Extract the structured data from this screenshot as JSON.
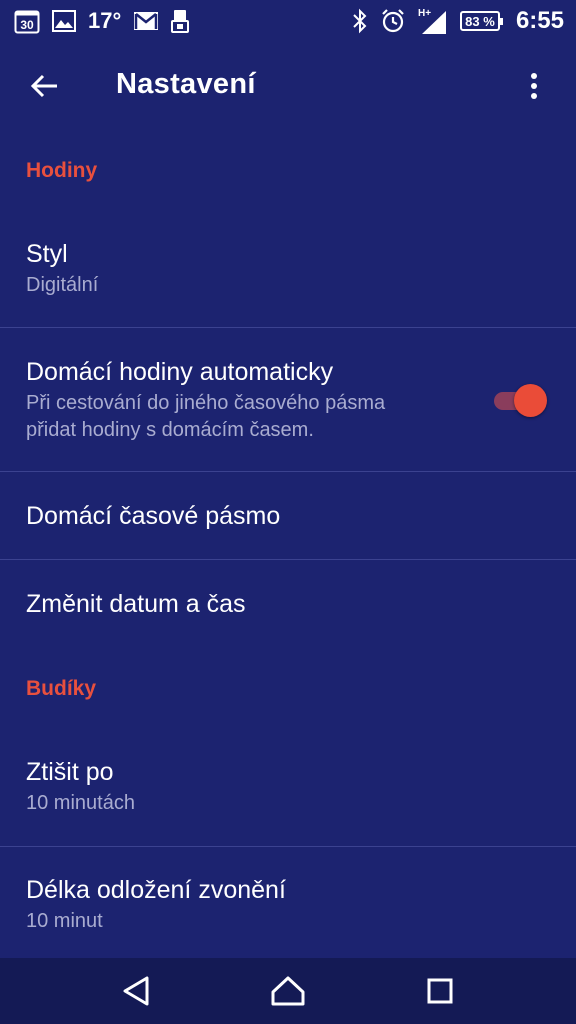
{
  "status_bar": {
    "calendar_day": "30",
    "temperature": "17°",
    "network_label": "H+",
    "battery": "83 %",
    "time": "6:55",
    "icons": [
      "calendar-icon",
      "gallery-icon",
      "gmail-icon",
      "device-icon",
      "bluetooth-icon",
      "alarm-icon",
      "signal-icon",
      "battery-icon"
    ]
  },
  "toolbar": {
    "title": "Nastavení",
    "back_icon": "arrow-back-icon",
    "menu_icon": "more-vert-icon"
  },
  "sections": {
    "clock": {
      "header": "Hodiny",
      "style_title": "Styl",
      "style_value": "Digitální",
      "auto_home_title": "Domácí hodiny automaticky",
      "auto_home_sub_line1": "Při cestování do jiného časového pásma",
      "auto_home_sub_line2": "přidat hodiny s domácím časem.",
      "auto_home_enabled": true,
      "home_tz_title": "Domácí časové pásmo",
      "change_datetime_title": "Změnit datum a čas"
    },
    "alarms": {
      "header": "Budíky",
      "silence_title": "Ztišit po",
      "silence_value": "10 minutách",
      "snooze_title": "Délka odložení zvonění",
      "snooze_value": "10 minut"
    }
  },
  "colors": {
    "background": "#1c2370",
    "accent": "#e8503e",
    "secondary_text": "#a9acd0",
    "nav_bar": "#141a55"
  },
  "nav_bar": {
    "icons": [
      "back-triangle-icon",
      "home-icon",
      "recents-icon"
    ]
  }
}
